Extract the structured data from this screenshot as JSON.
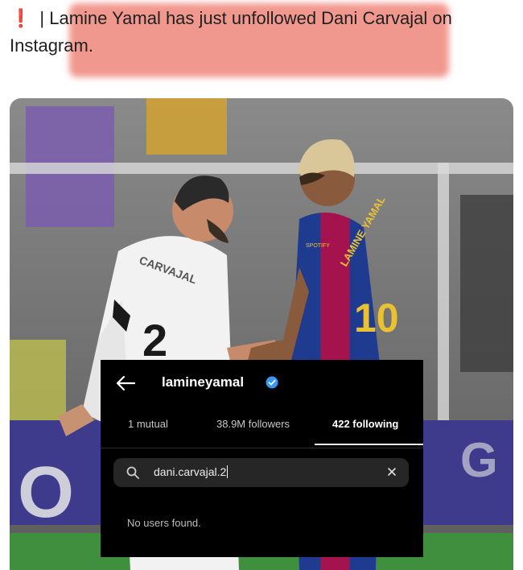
{
  "tweet": {
    "alert_icon": "exclamation-icon",
    "text": "| Lamine Yamal has just unfollowed Dani Carvajal on Instagram.",
    "highlight_color": "#ec7063"
  },
  "instagram": {
    "username": "lamineyamal",
    "verified": true,
    "tabs": [
      {
        "label": "1 mutual"
      },
      {
        "label": "38.9M followers"
      },
      {
        "label": "422 following"
      }
    ],
    "active_tab": 2,
    "search": {
      "value": "dani.carvajal.2"
    },
    "empty_message": "No users found.",
    "colors": {
      "background": "#000000",
      "verified": "#3897f0"
    }
  }
}
